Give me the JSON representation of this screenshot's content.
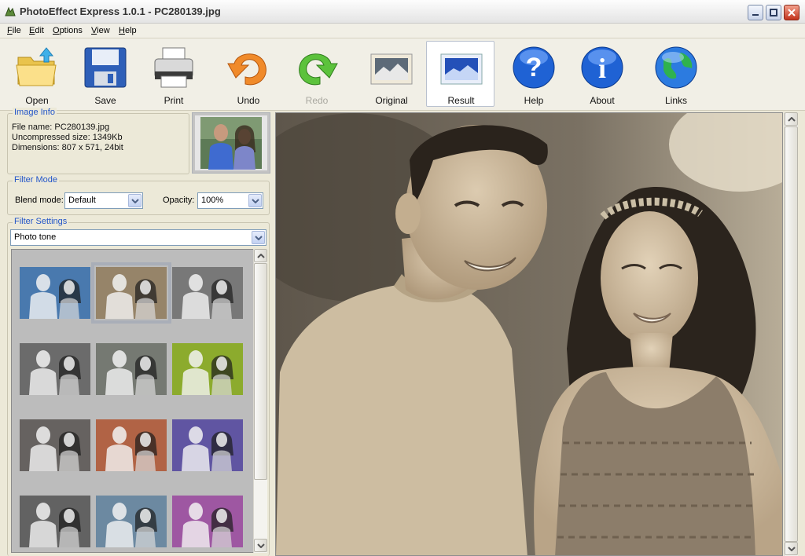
{
  "window": {
    "title": "PhotoEffect Express 1.0.1 - PC280139.jpg"
  },
  "menu": [
    "File",
    "Edit",
    "Options",
    "View",
    "Help"
  ],
  "toolbar": {
    "open": "Open",
    "save": "Save",
    "print": "Print",
    "undo": "Undo",
    "redo": "Redo",
    "original": "Original",
    "result": "Result",
    "help": "Help",
    "about": "About",
    "links": "Links"
  },
  "image_info": {
    "title": "Image Info",
    "file_name": "File name: PC280139.jpg",
    "uncompressed_size": "Uncompressed size: 1349Kb",
    "dimensions": "Dimensions: 807 x 571, 24bit"
  },
  "filter_mode": {
    "title": "Filter Mode",
    "blend_label": "Blend mode:",
    "blend_value": "Default",
    "opacity_label": "Opacity:",
    "opacity_value": "100%"
  },
  "filter_settings": {
    "title": "Filter Settings",
    "selected": "Photo tone",
    "thumbnails": [
      {
        "tint": "#4f8fd6"
      },
      {
        "tint": "#b59d7a"
      },
      {
        "tint": "#8e8e8e"
      },
      {
        "tint": "#7c7c7c"
      },
      {
        "tint": "#8a8f85"
      },
      {
        "tint": "#a8d22a"
      },
      {
        "tint": "#76706e"
      },
      {
        "tint": "#d9714a"
      },
      {
        "tint": "#6d5fc6"
      },
      {
        "tint": "#707070"
      },
      {
        "tint": "#7ea4c4"
      },
      {
        "tint": "#c062c6"
      }
    ],
    "selected_index": 1
  },
  "colors": {
    "accent": "#2255c8",
    "sepia_bg": "#6b6357",
    "sepia_skin": "#d4c2a6"
  }
}
